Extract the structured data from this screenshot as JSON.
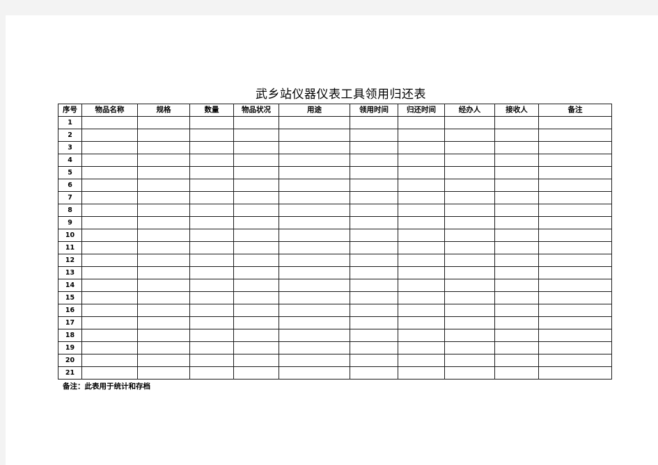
{
  "document": {
    "title": "武乡站仪器仪表工具领用归还表",
    "footnote": "备注：此表用于统计和存档"
  },
  "table": {
    "columns": [
      {
        "key": "seq",
        "label": "序号"
      },
      {
        "key": "item_name",
        "label": "物品名称"
      },
      {
        "key": "spec",
        "label": "规格"
      },
      {
        "key": "quantity",
        "label": "数量"
      },
      {
        "key": "condition",
        "label": "物品状况"
      },
      {
        "key": "purpose",
        "label": "用途"
      },
      {
        "key": "borrow_time",
        "label": "领用时间"
      },
      {
        "key": "return_time",
        "label": "归还时间"
      },
      {
        "key": "handler",
        "label": "经办人"
      },
      {
        "key": "receiver",
        "label": "接收人"
      },
      {
        "key": "remarks",
        "label": "备注"
      }
    ],
    "rows": [
      {
        "seq": "1"
      },
      {
        "seq": "2"
      },
      {
        "seq": "3"
      },
      {
        "seq": "4"
      },
      {
        "seq": "5"
      },
      {
        "seq": "6"
      },
      {
        "seq": "7"
      },
      {
        "seq": "8"
      },
      {
        "seq": "9"
      },
      {
        "seq": "10"
      },
      {
        "seq": "11"
      },
      {
        "seq": "12"
      },
      {
        "seq": "13"
      },
      {
        "seq": "14"
      },
      {
        "seq": "15"
      },
      {
        "seq": "16"
      },
      {
        "seq": "17"
      },
      {
        "seq": "18"
      },
      {
        "seq": "19"
      },
      {
        "seq": "20"
      },
      {
        "seq": "21"
      }
    ]
  }
}
